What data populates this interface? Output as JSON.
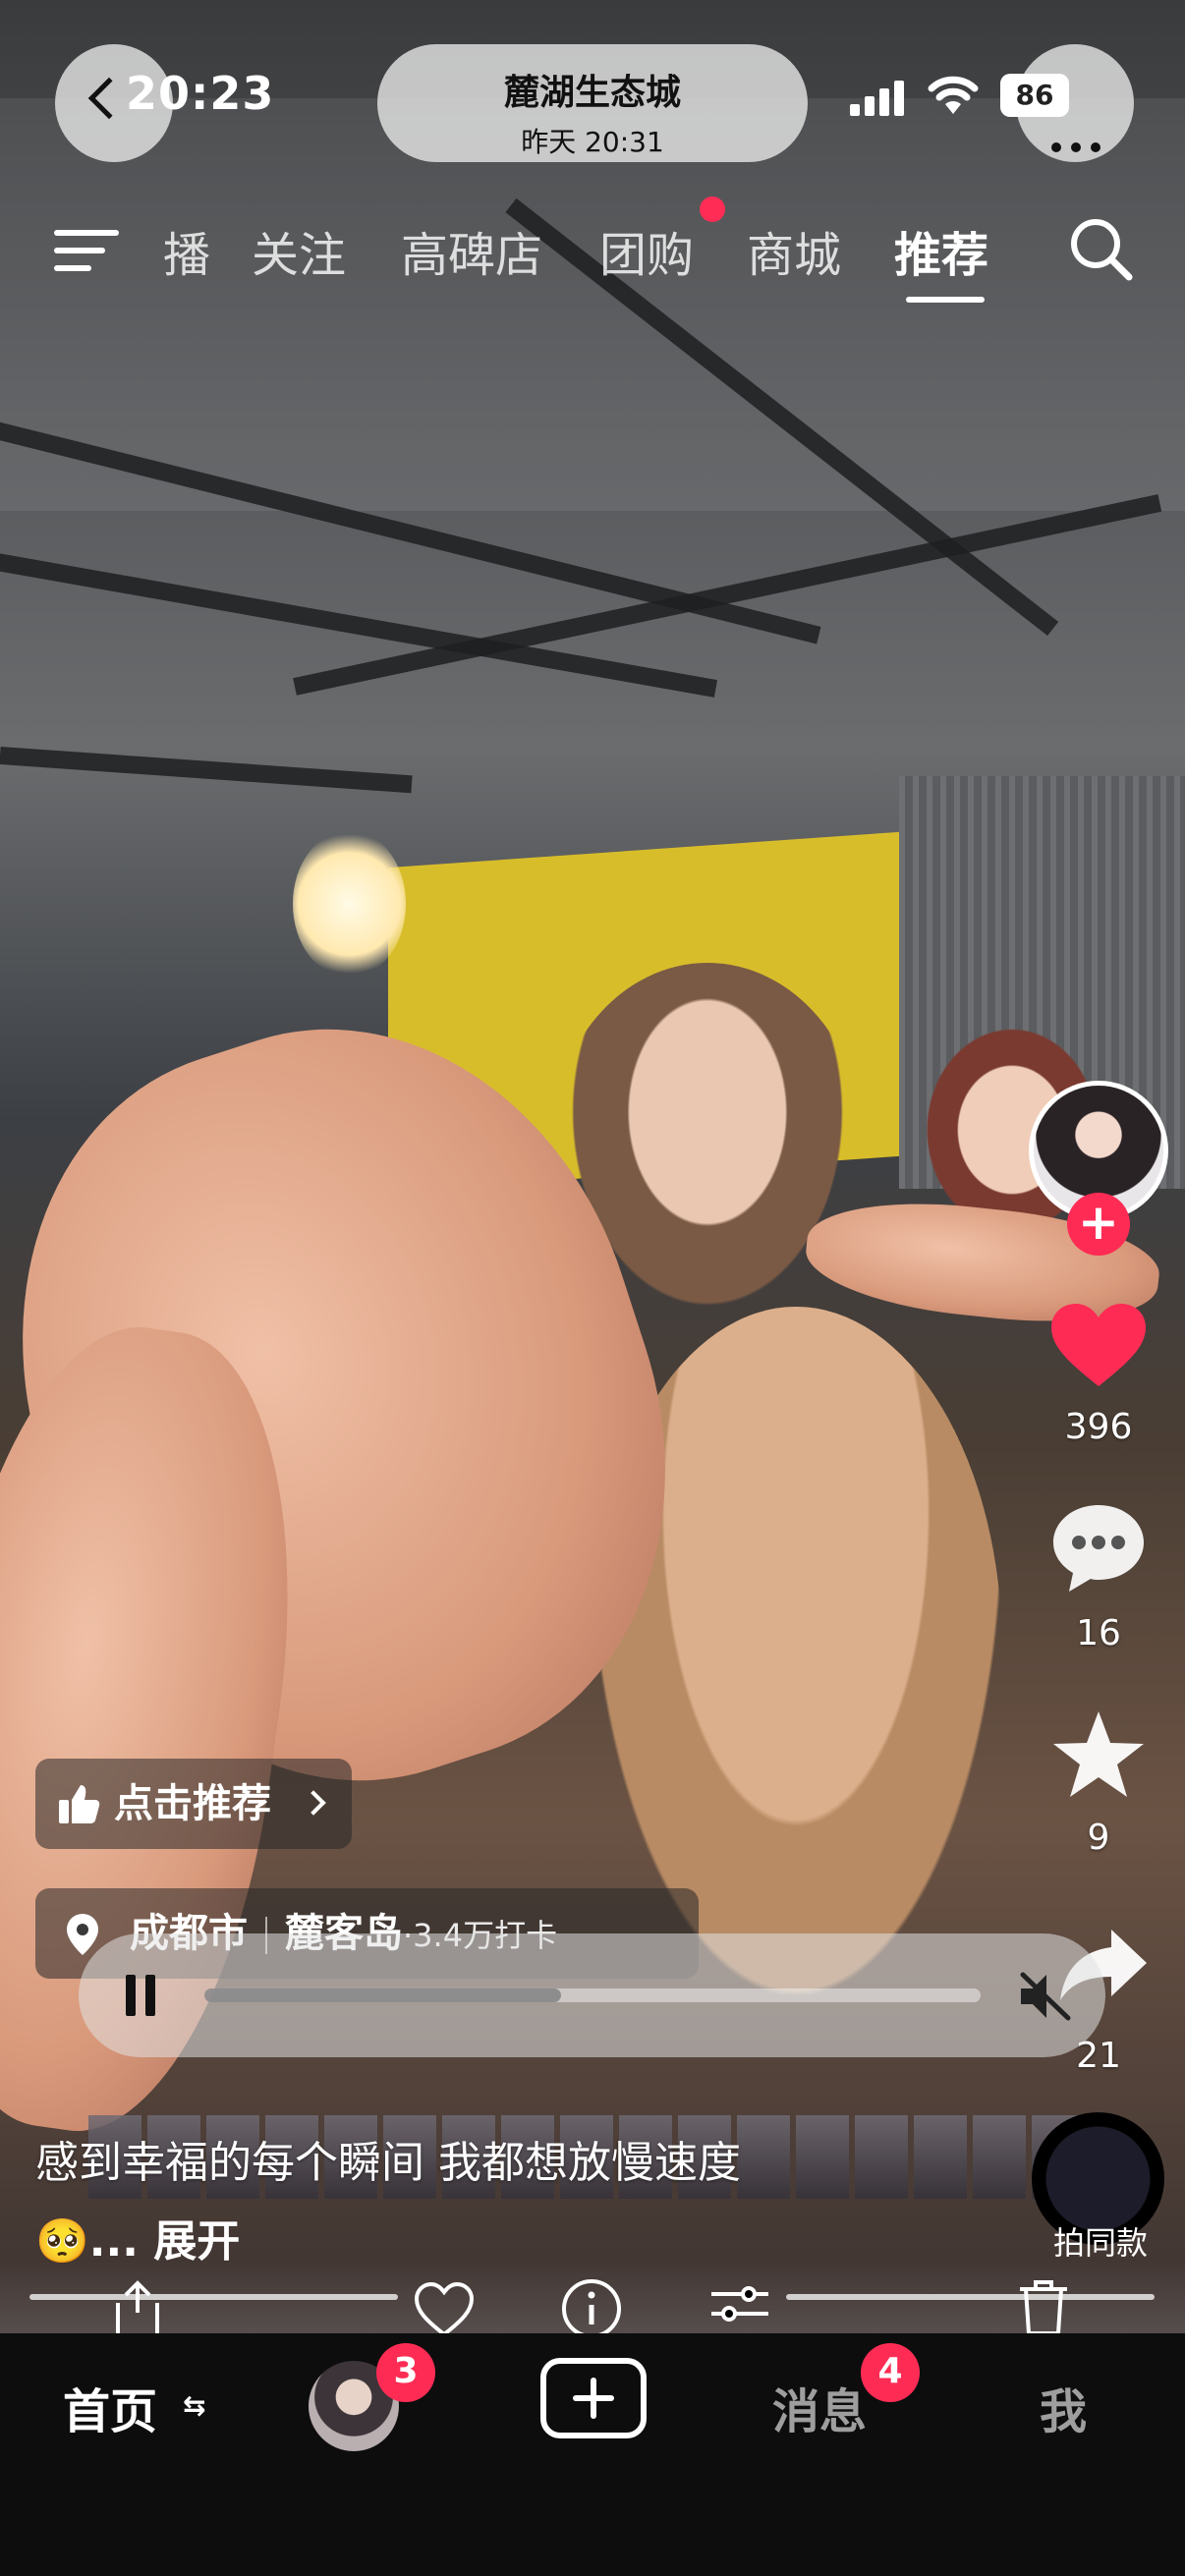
{
  "status_bar": {
    "time": "20:23",
    "battery": "86"
  },
  "location_header": {
    "title": "麓湖生态城",
    "subtitle": "昨天 20:31"
  },
  "top_tabs": [
    {
      "label": "播",
      "active": false
    },
    {
      "label": "关注",
      "active": false
    },
    {
      "label": "高碑店",
      "active": false
    },
    {
      "label": "团购",
      "active": false,
      "dot": true
    },
    {
      "label": "商城",
      "active": false
    },
    {
      "label": "推荐",
      "active": true
    }
  ],
  "rail": {
    "likes": "396",
    "comments": "16",
    "favorites": "9",
    "shares": "21",
    "same_label": "拍同款"
  },
  "recommend": {
    "label": "点击推荐"
  },
  "location": {
    "city": "成都市",
    "place": "麓客岛",
    "checkins": "·3.4万打卡"
  },
  "player": {
    "progress": 0.46
  },
  "caption": {
    "text": "感到幸福的每个瞬间 我都想放慢速度",
    "emoji": "🥺",
    "expand": "... 展开"
  },
  "bottom_tabs": {
    "home": "首页",
    "friends_badge": "3",
    "messages": "消息",
    "messages_badge": "4",
    "me": "我"
  },
  "colors": {
    "accent": "#fe2c55",
    "yellow_wall": "#d8bd2b"
  }
}
